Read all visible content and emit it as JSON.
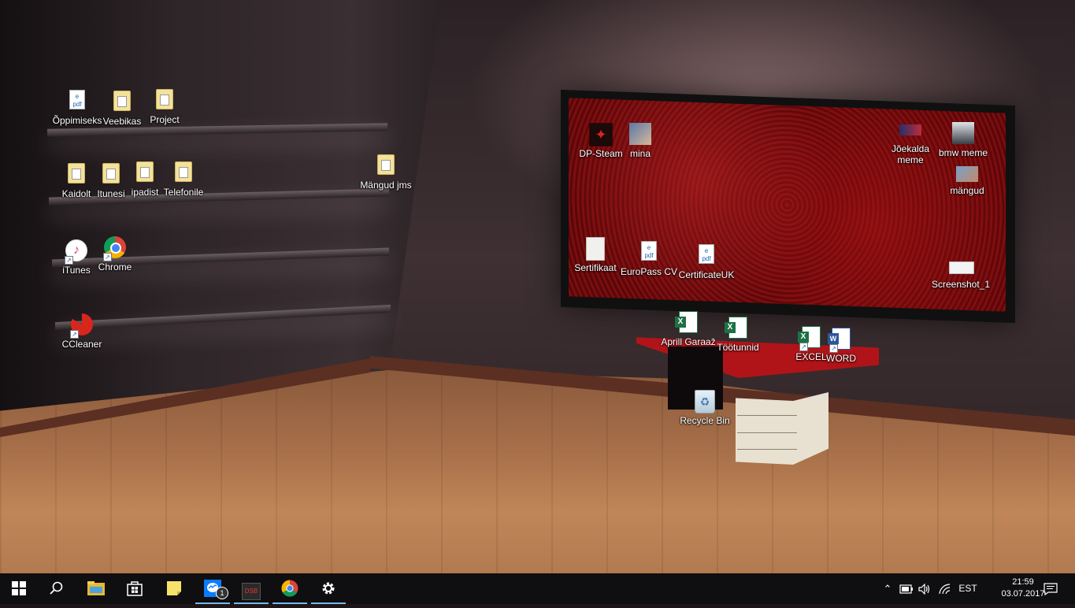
{
  "desktop": {
    "icons": [
      {
        "label": "Õppimiseks",
        "icon": "pdf-folder-icon"
      },
      {
        "label": "Veebikas",
        "icon": "folder-icon"
      },
      {
        "label": "Project",
        "icon": "folder-icon"
      },
      {
        "label": "Kaidolt",
        "icon": "folder-icon"
      },
      {
        "label": "Itunesi",
        "icon": "folder-icon"
      },
      {
        "label": "ipadist",
        "icon": "folder-icon"
      },
      {
        "label": "Telefonile",
        "icon": "folder-icon"
      },
      {
        "label": "Mängud jms",
        "icon": "folder-icon"
      },
      {
        "label": "iTunes",
        "icon": "itunes-icon"
      },
      {
        "label": "Chrome",
        "icon": "chrome-icon"
      },
      {
        "label": "CCleaner",
        "icon": "ccleaner-icon"
      },
      {
        "label": "DP-Steam",
        "icon": "image-icon"
      },
      {
        "label": "mina",
        "icon": "photo-icon"
      },
      {
        "label": "Jõekalda meme",
        "icon": "photo-icon"
      },
      {
        "label": "bmw meme",
        "icon": "photo-icon"
      },
      {
        "label": "mängud",
        "icon": "photo-icon"
      },
      {
        "label": "Sertifikaat",
        "icon": "document-icon"
      },
      {
        "label": "EuroPass CV",
        "icon": "pdf-icon"
      },
      {
        "label": "CertificateUK",
        "icon": "pdf-icon"
      },
      {
        "label": "Screenshot_1",
        "icon": "image-icon"
      },
      {
        "label": "Aprill Garaaž",
        "icon": "excel-file-icon"
      },
      {
        "label": "Töötunnid",
        "icon": "excel-file-icon"
      },
      {
        "label": "EXCEL",
        "icon": "excel-icon"
      },
      {
        "label": "WORD",
        "icon": "word-icon"
      },
      {
        "label": "Recycle Bin",
        "icon": "recycle-bin-icon"
      }
    ]
  },
  "taskbar": {
    "pinned": [
      {
        "name": "start",
        "icon": "windows-icon"
      },
      {
        "name": "search",
        "icon": "search-icon"
      },
      {
        "name": "file-explorer",
        "icon": "folder-icon"
      },
      {
        "name": "store",
        "icon": "store-icon"
      },
      {
        "name": "sticky-notes",
        "icon": "note-icon"
      },
      {
        "name": "messenger",
        "icon": "messenger-icon",
        "badge": "1"
      },
      {
        "name": "dsb",
        "icon": "dsb-icon",
        "label": "DSB"
      },
      {
        "name": "chrome",
        "icon": "chrome-icon"
      },
      {
        "name": "settings",
        "icon": "gear-icon"
      }
    ],
    "tray": {
      "language": "EST",
      "time": "21:59",
      "date": "03.07.2017"
    }
  },
  "colors": {
    "taskbar_bg": "#0f0f11",
    "active_indicator": "#76b9ed"
  }
}
